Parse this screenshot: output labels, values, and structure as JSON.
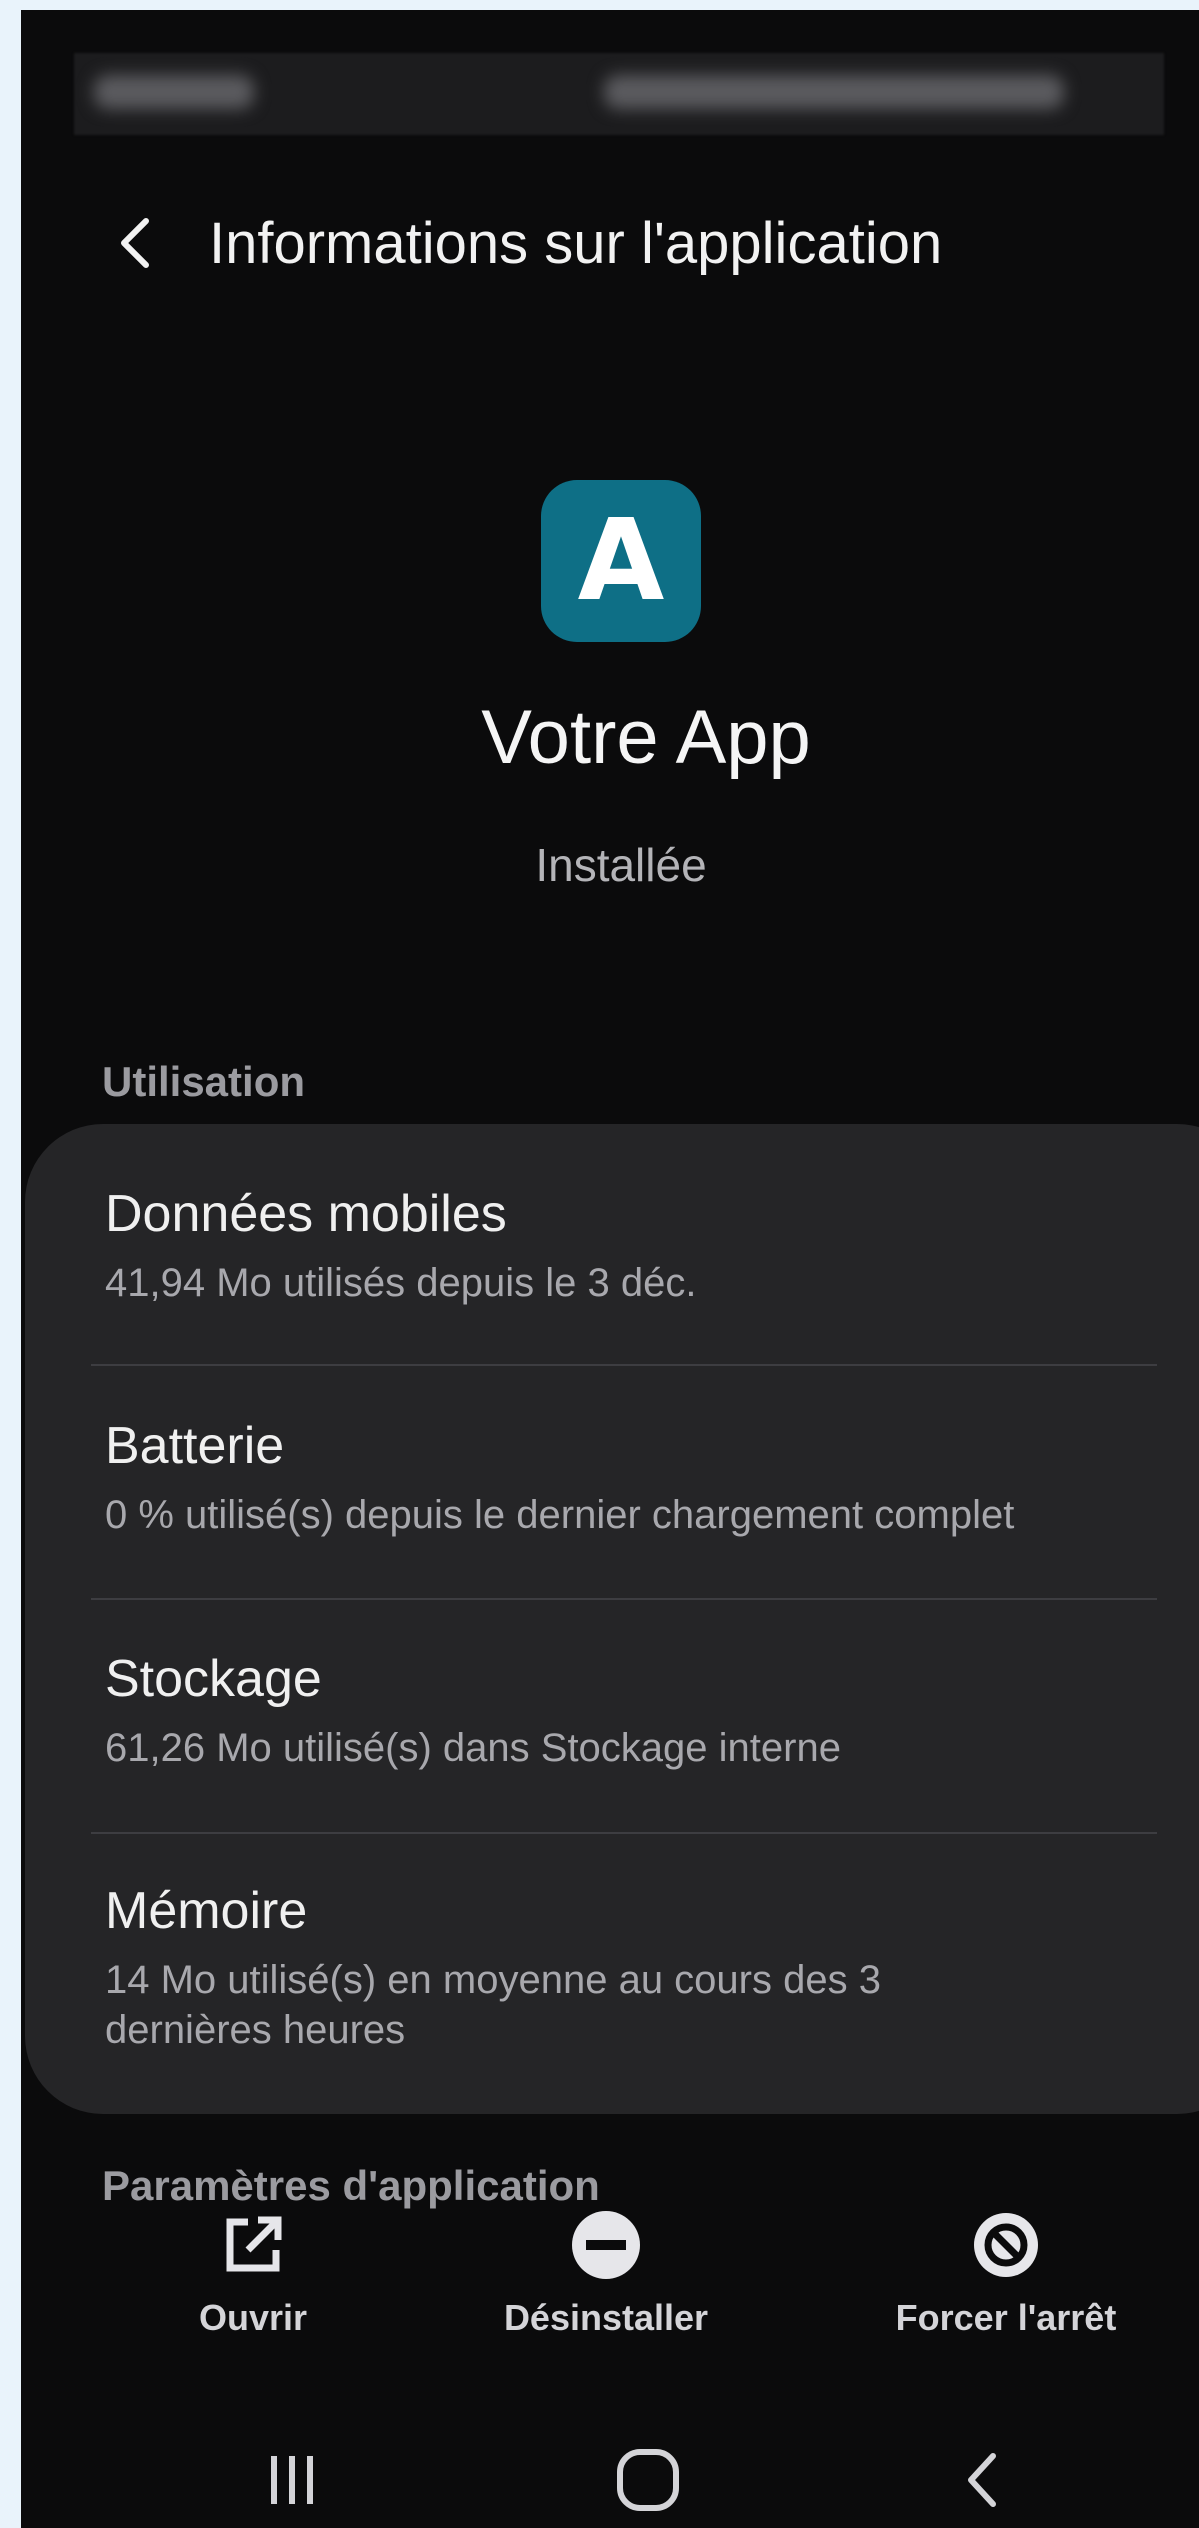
{
  "header": {
    "title": "Informations sur l'application",
    "back_icon": "chevron-left-icon"
  },
  "app": {
    "icon_letter": "A",
    "icon_color": "#0e6f86",
    "name": "Votre App",
    "status": "Installée"
  },
  "usage": {
    "section_title": "Utilisation",
    "items": [
      {
        "title": "Données mobiles",
        "subtitle": "41,94 Mo utilisés depuis le 3 déc."
      },
      {
        "title": "Batterie",
        "subtitle": "0 % utilisé(s) depuis le dernier chargement complet"
      },
      {
        "title": "Stockage",
        "subtitle": "61,26 Mo utilisé(s) dans Stockage interne"
      },
      {
        "title": "Mémoire",
        "subtitle": "14 Mo utilisé(s) en moyenne au cours des 3 dernières heures"
      }
    ]
  },
  "settings_section": {
    "title": "Paramètres d'application"
  },
  "actions": [
    {
      "label": "Ouvrir",
      "icon": "open-external-icon"
    },
    {
      "label": "Désinstaller",
      "icon": "minus-circle-icon"
    },
    {
      "label": "Forcer l'arrêt",
      "icon": "block-icon"
    }
  ],
  "nav": {
    "recent_icon": "recent-apps-icon",
    "home_icon": "home-icon",
    "back_icon": "back-icon"
  },
  "colors": {
    "background": "#0b0b0c",
    "card": "#252527",
    "accent": "#0e6f86"
  }
}
